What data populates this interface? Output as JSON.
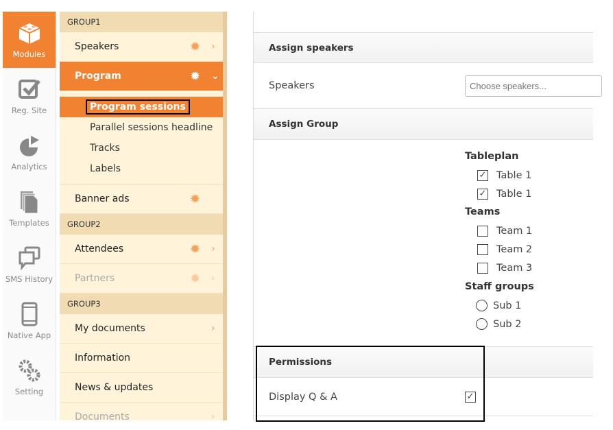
{
  "rail": [
    {
      "label": "Modules",
      "icon": "lego-blocks-icon",
      "active": true
    },
    {
      "label": "Reg. Site",
      "icon": "checkbox-icon"
    },
    {
      "label": "Analytics",
      "icon": "pie-chart-icon"
    },
    {
      "label": "Templates",
      "icon": "documents-icon"
    },
    {
      "label": "SMS History",
      "icon": "chat-bubbles-icon"
    },
    {
      "label": "Native App",
      "icon": "mobile-icon"
    },
    {
      "label": "Setting",
      "icon": "gears-icon"
    }
  ],
  "nav": {
    "group1": "GROUP1",
    "speakers": "Speakers",
    "program": "Program",
    "program_sessions": "Program sessions",
    "parallel": "Parallel sessions headline",
    "tracks": "Tracks",
    "labels": "Labels",
    "banner_ads": "Banner ads",
    "group2": "GROUP2",
    "attendees": "Attendees",
    "partners": "Partners",
    "group3": "GROUP3",
    "my_documents": "My documents",
    "information": "Information",
    "news": "News & updates",
    "documents": "Documents"
  },
  "main": {
    "assign_speakers": "Assign speakers",
    "speakers_label": "Speakers",
    "speakers_placeholder": "Choose speakers...",
    "assign_group": "Assign Group",
    "tableplan": "Tableplan",
    "tables": [
      {
        "label": "Table 1",
        "checked": true
      },
      {
        "label": "Table 1",
        "checked": true
      }
    ],
    "teams": "Teams",
    "team_items": [
      {
        "label": "Team 1",
        "checked": false
      },
      {
        "label": "Team 2",
        "checked": false
      },
      {
        "label": "Team 3",
        "checked": false
      }
    ],
    "staff_groups": "Staff groups",
    "staff_items": [
      {
        "label": "Sub 1"
      },
      {
        "label": "Sub 2"
      }
    ],
    "permissions": "Permissions",
    "display_qa": "Display Q & A",
    "display_qa_checked": true
  },
  "colors": {
    "accent": "#f08232",
    "nav_bg": "#fff3d9",
    "group_bg": "#f0dbb3"
  }
}
